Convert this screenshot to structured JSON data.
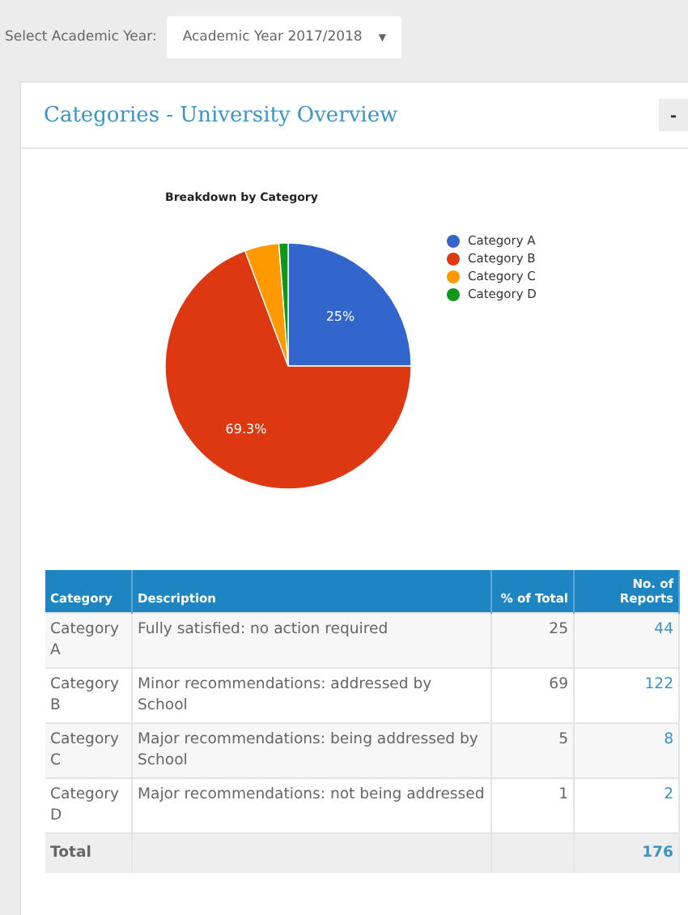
{
  "year_selector": {
    "label": "Select Academic Year:",
    "value": "Academic Year 2017/2018",
    "caret": "▼"
  },
  "panel": {
    "title": "Categories - University Overview",
    "collapse_button": "-",
    "chart": {
      "chart_data": {
        "type": "pie",
        "title": "Breakdown by Category",
        "categories": [
          "Category A",
          "Category B",
          "Category C",
          "Category D"
        ],
        "values": [
          25,
          69.3,
          4.5,
          1.2
        ],
        "legend": "right",
        "colors": [
          "#3366cc",
          "#dc3912",
          "#ff9900",
          "#109618"
        ],
        "value_labels": [
          "25%",
          "69.3%",
          null,
          null
        ]
      }
    },
    "table": {
      "columns": [
        "Category",
        "Description",
        "% of Total",
        "No. of Reports"
      ],
      "rows": [
        {
          "category": "Category A",
          "description": "Fully satisfied: no action required",
          "percent": "25",
          "reports": "44"
        },
        {
          "category": "Category B",
          "description": "Minor recommendations: addressed by School",
          "percent": "69",
          "reports": "122"
        },
        {
          "category": "Category C",
          "description": "Major recommendations: being addressed by School",
          "percent": "5",
          "reports": "8"
        },
        {
          "category": "Category D",
          "description": "Major recommendations: not being addressed",
          "percent": "1",
          "reports": "2"
        }
      ],
      "total": {
        "label": "Total",
        "reports": "176"
      }
    }
  }
}
